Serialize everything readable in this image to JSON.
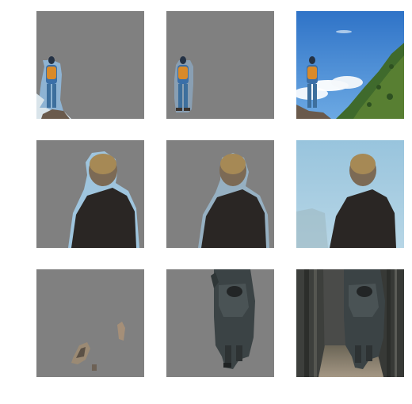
{
  "figure": {
    "rows": 3,
    "cols": 3,
    "panels": [
      {
        "row": 1,
        "col": 1,
        "scene": "hiker-on-cliff",
        "variant": "mask-coarse",
        "background": "#808080"
      },
      {
        "row": 1,
        "col": 2,
        "scene": "hiker-on-cliff",
        "variant": "mask-refined",
        "background": "#808080"
      },
      {
        "row": 1,
        "col": 3,
        "scene": "hiker-on-cliff",
        "variant": "original-photo",
        "background": "#3f7ec9"
      },
      {
        "row": 2,
        "col": 1,
        "scene": "person-back-view",
        "variant": "mask-coarse",
        "background": "#808080"
      },
      {
        "row": 2,
        "col": 2,
        "scene": "person-back-view",
        "variant": "mask-refined",
        "background": "#808080"
      },
      {
        "row": 2,
        "col": 3,
        "scene": "person-back-view",
        "variant": "original-photo",
        "background": "#a9cfe2"
      },
      {
        "row": 3,
        "col": 1,
        "scene": "figure-in-alley",
        "variant": "mask-coarse",
        "background": "#808080"
      },
      {
        "row": 3,
        "col": 2,
        "scene": "figure-in-alley",
        "variant": "mask-refined",
        "background": "#808080"
      },
      {
        "row": 3,
        "col": 3,
        "scene": "figure-in-alley",
        "variant": "original-photo",
        "background": "#4a4b49"
      }
    ]
  }
}
